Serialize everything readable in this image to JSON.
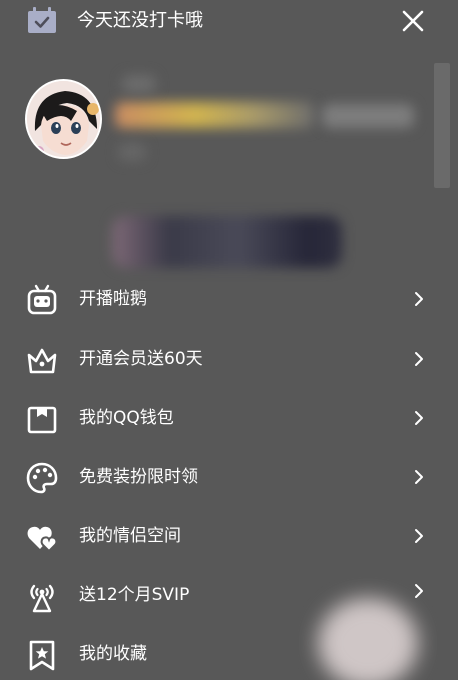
{
  "header": {
    "checkin_text": "今天还没打卡哦"
  },
  "icons": {
    "calendar": "calendar-check-icon",
    "close": "close-icon",
    "chevron": "chevron-right-icon"
  },
  "menu": {
    "items": [
      {
        "label": "开播啦鹅",
        "icon": "robot-tv-icon"
      },
      {
        "label": "开通会员送60天",
        "icon": "crown-icon"
      },
      {
        "label": "我的QQ钱包",
        "icon": "wallet-icon"
      },
      {
        "label": "免费装扮限时领",
        "icon": "palette-icon"
      },
      {
        "label": "我的情侣空间",
        "icon": "hearts-icon"
      },
      {
        "label": "送12个月SVIP",
        "icon": "broadcast-tower-icon"
      },
      {
        "label": "我的收藏",
        "icon": "bookmark-star-icon"
      }
    ]
  },
  "colors": {
    "background": "#585858",
    "text": "#ffffff",
    "icon": "#ffffff"
  }
}
